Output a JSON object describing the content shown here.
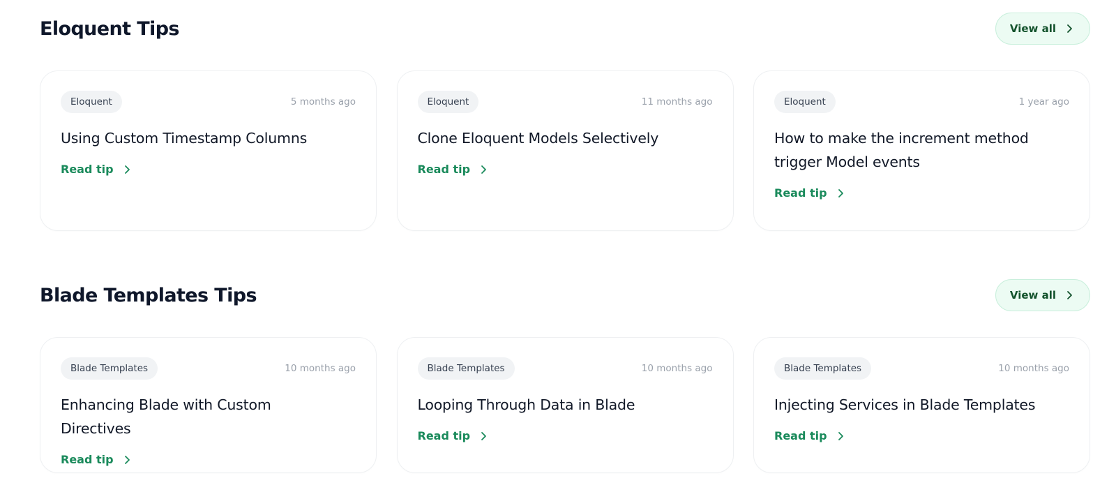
{
  "colors": {
    "accent": "#1a8a5b",
    "view_all_bg": "#ecfbf3",
    "tag_bg": "#f1f3f5"
  },
  "sections": [
    {
      "title": "Eloquent Tips",
      "view_all_label": "View all",
      "cards": [
        {
          "tag": "Eloquent",
          "time": "5 months ago",
          "title": "Using Custom Timestamp Columns",
          "link": "Read tip"
        },
        {
          "tag": "Eloquent",
          "time": "11 months ago",
          "title": "Clone Eloquent Models Selectively",
          "link": "Read tip"
        },
        {
          "tag": "Eloquent",
          "time": "1 year ago",
          "title": "How to make the increment method trigger Model events",
          "link": "Read tip"
        }
      ]
    },
    {
      "title": "Blade Templates Tips",
      "view_all_label": "View all",
      "cards": [
        {
          "tag": "Blade Templates",
          "time": "10 months ago",
          "title": "Enhancing Blade with Custom Directives",
          "link": "Read tip"
        },
        {
          "tag": "Blade Templates",
          "time": "10 months ago",
          "title": "Looping Through Data in Blade",
          "link": "Read tip"
        },
        {
          "tag": "Blade Templates",
          "time": "10 months ago",
          "title": "Injecting Services in Blade Templates",
          "link": "Read tip"
        }
      ]
    }
  ]
}
